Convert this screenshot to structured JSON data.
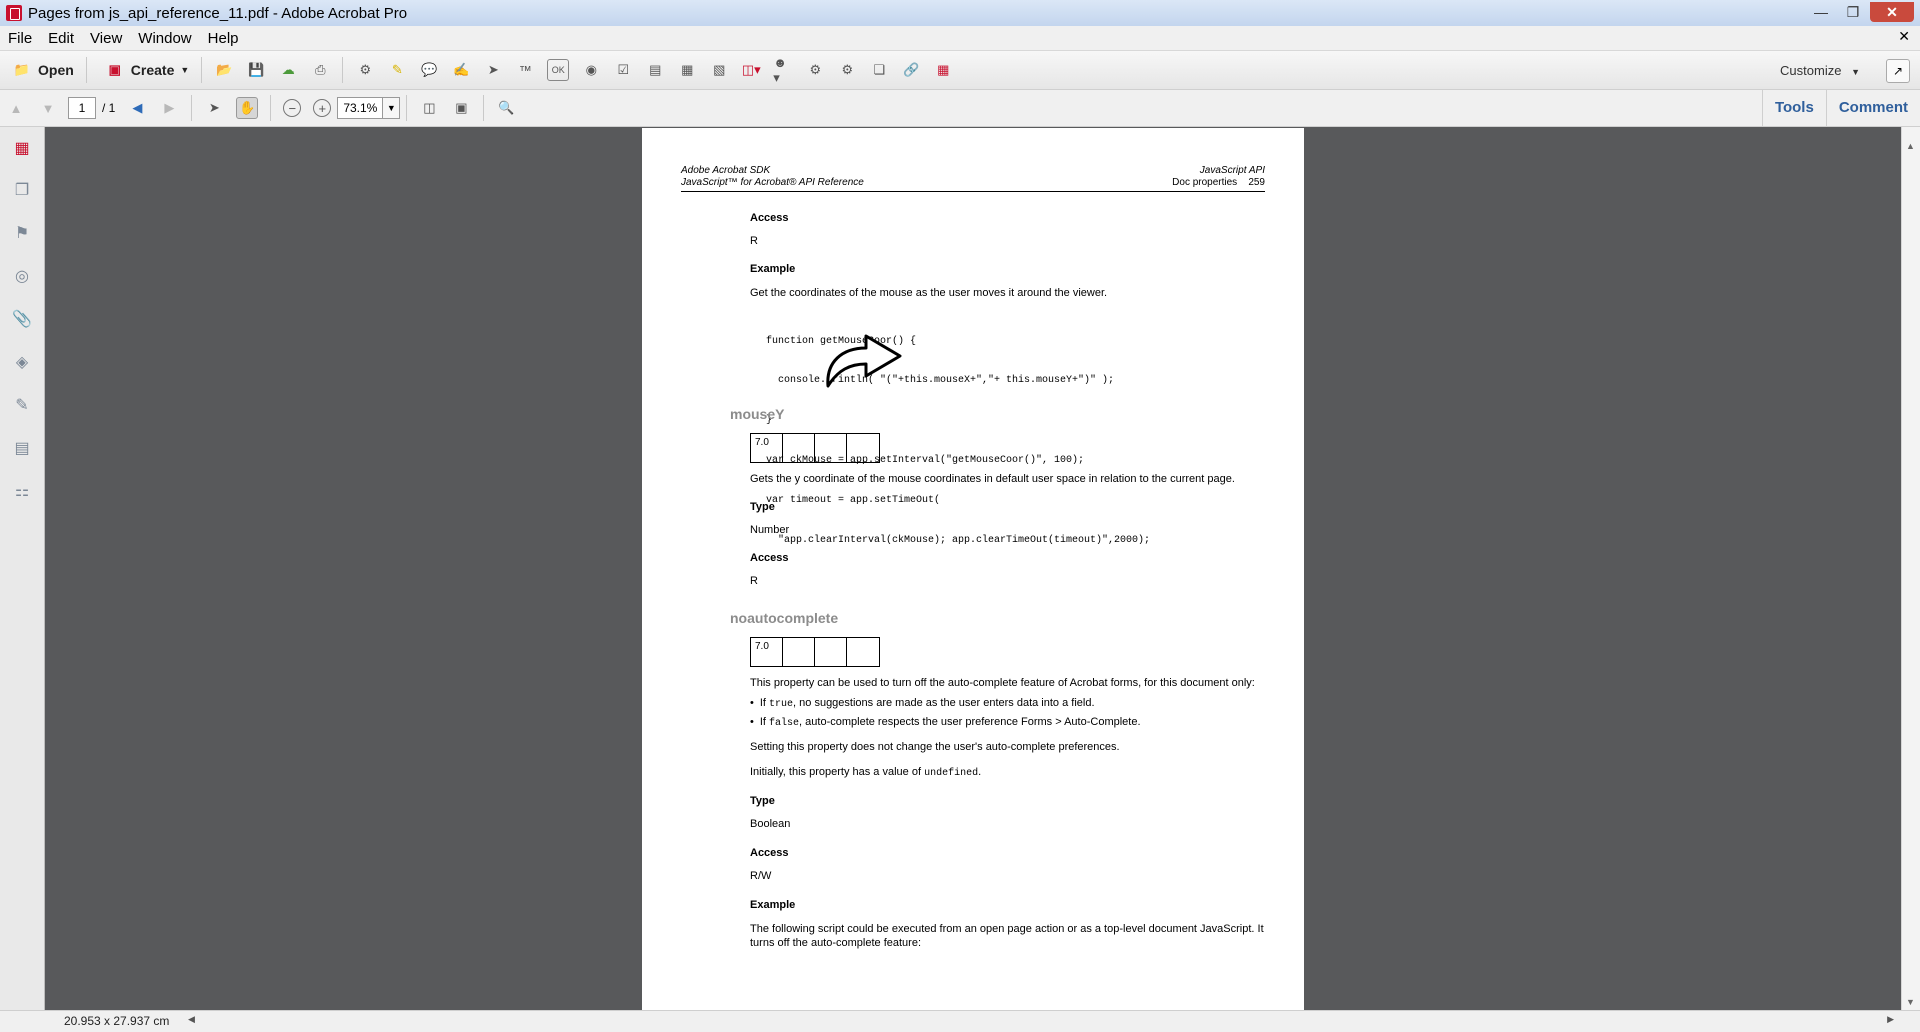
{
  "window": {
    "title": "Pages from js_api_reference_11.pdf - Adobe Acrobat Pro"
  },
  "menu": [
    "File",
    "Edit",
    "View",
    "Window",
    "Help"
  ],
  "toolbar": {
    "open_label": "Open",
    "create_label": "Create",
    "customize_label": "Customize"
  },
  "nav": {
    "page_current": "1",
    "page_total": "/ 1",
    "zoom": "73.1%"
  },
  "panel_tabs": {
    "tools": "Tools",
    "comment": "Comment"
  },
  "status": {
    "page_size": "20.953 x 27.937 cm"
  },
  "document": {
    "header_left_1": "Adobe Acrobat SDK",
    "header_left_2": "JavaScript™ for Acrobat® API Reference",
    "header_right_1": "JavaScript API",
    "header_right_2": "Doc properties",
    "page_number": "259",
    "access_heading_1": "Access",
    "access_value_1": "R",
    "example_heading_1": "Example",
    "example_text_1": "Get the coordinates of the mouse as the user moves it around the viewer.",
    "code_lines": [
      "function getMouseCoor() {",
      "  console.println( \"(\"+this.mouseX+\",\"+ this.mouseY+\")\" );",
      "}",
      "var ckMouse = app.setInterval(\"getMouseCoor()\", 100);",
      "var timeout = app.setTimeOut(",
      "  \"app.clearInterval(ckMouse); app.clearTimeOut(timeout)\",2000);"
    ],
    "mousey_title": "mouseY",
    "mousey_version": "7.0",
    "mousey_desc": "Gets the y coordinate of the mouse coordinates in default user space in relation to the current page.",
    "type_heading_1": "Type",
    "type_value_1": "Number",
    "access_heading_2": "Access",
    "access_value_2": "R",
    "noauto_title": "noautocomplete",
    "noauto_version": "7.0",
    "noauto_desc": "This property can be used to turn off the auto-complete feature of Acrobat forms, for this document only:",
    "bullet1_pre": "If ",
    "bullet1_code": "true",
    "bullet1_post": ", no suggestions are made as the user enters data into a field.",
    "bullet2_pre": "If ",
    "bullet2_code": "false",
    "bullet2_post": ", auto-complete respects the user preference Forms > Auto-Complete.",
    "setting_text": "Setting this property does not change the user's auto-complete preferences.",
    "initially_pre": "Initially, this property has a value of ",
    "initially_code": "undefined",
    "initially_post": ".",
    "type_heading_2": "Type",
    "type_value_2": "Boolean",
    "access_heading_3": "Access",
    "access_value_3": "R/W",
    "example_heading_2": "Example",
    "example_text_2a": "The following script could be executed from an open page action or as a top-level document JavaScript. It",
    "example_text_2b": "turns off the auto-complete feature:"
  }
}
